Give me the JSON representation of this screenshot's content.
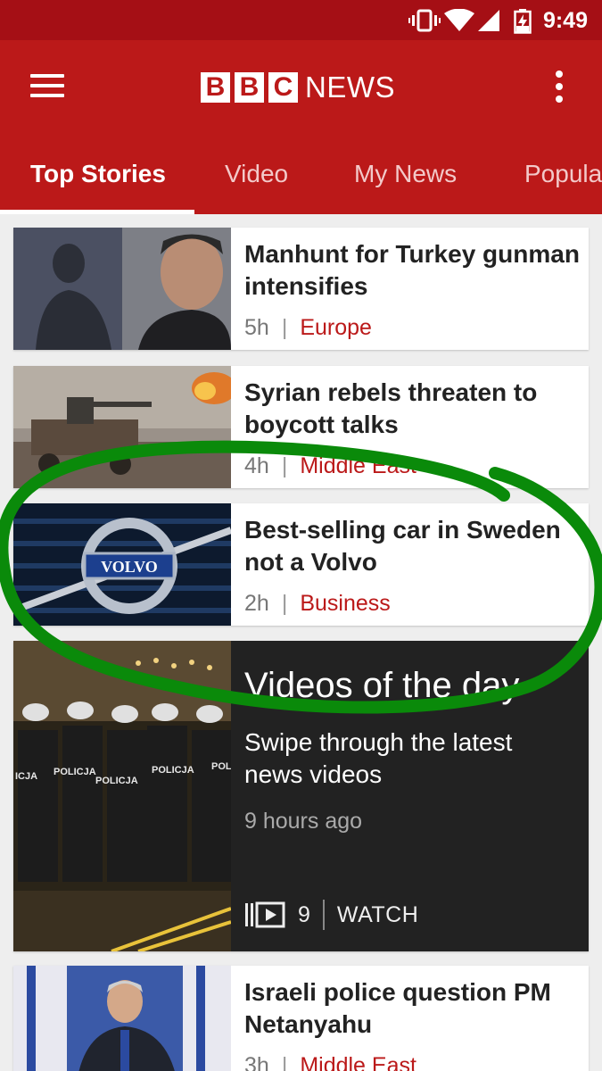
{
  "status_bar": {
    "time": "9:49",
    "icons": [
      "vibrate-icon",
      "wifi-icon",
      "signal-icon",
      "battery-charging-icon"
    ]
  },
  "app_bar": {
    "menu_icon": "hamburger-menu-icon",
    "logo": {
      "letters": [
        "B",
        "B",
        "C"
      ],
      "text": "NEWS"
    },
    "overflow_icon": "overflow-menu-icon",
    "tabs": [
      {
        "label": "Top Stories",
        "active": true
      },
      {
        "label": "Video"
      },
      {
        "label": "My News"
      },
      {
        "label": "Popula"
      }
    ]
  },
  "stories": [
    {
      "headline": "Manhunt for Turkey gunman intensifies",
      "age": "5h",
      "separator": "|",
      "category": "Europe"
    },
    {
      "headline": "Syrian rebels threaten to boycott talks",
      "age": "4h",
      "separator": "|",
      "category": "Middle East"
    },
    {
      "headline": "Best-selling car in Sweden not a Volvo",
      "age": "2h",
      "separator": "|",
      "category": "Business",
      "thumb_text": "VOLVO"
    },
    {
      "headline": "Israeli police question PM Netanyahu",
      "age": "3h",
      "separator": "|",
      "category": "Middle East"
    }
  ],
  "videos_of_the_day": {
    "title": "Videos of the day",
    "subtitle": "Swipe through the latest news videos",
    "time": "9 hours ago",
    "count": "9",
    "watch_label": "WATCH",
    "icon": "video-playlist-icon",
    "thumb_text": [
      "POLICJA",
      "POLICJA",
      "POLICJA",
      "POLI",
      "ICJA"
    ]
  },
  "colors": {
    "brand_red": "#bb1919",
    "status_bar": "#a50f15",
    "annotation_green": "#0a8a0a",
    "video_bg": "#222222"
  }
}
